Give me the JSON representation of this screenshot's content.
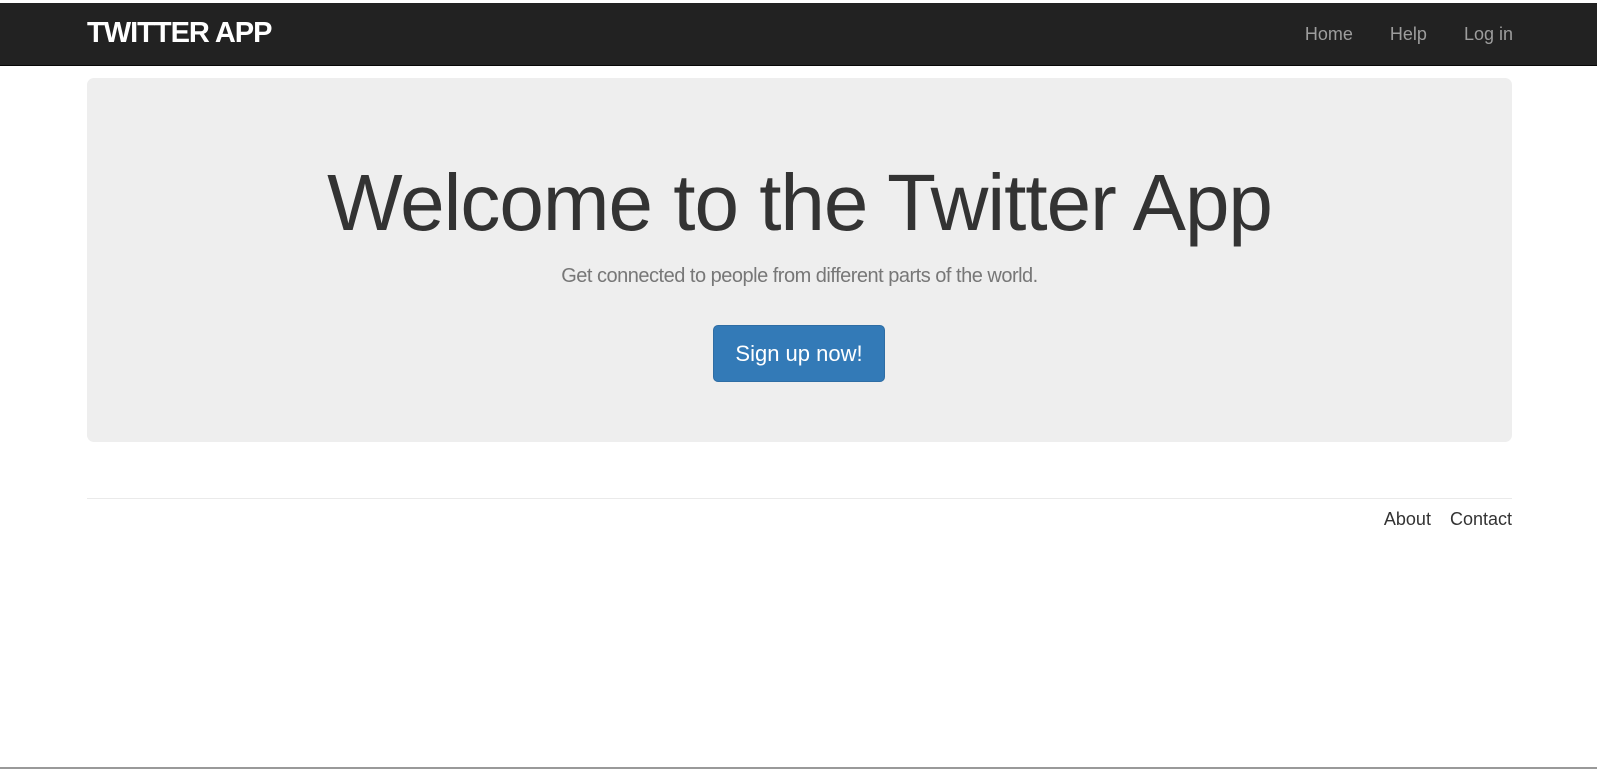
{
  "navbar": {
    "brand": "TWITTER APP",
    "links": [
      "Home",
      "Help",
      "Log in"
    ]
  },
  "hero": {
    "title": "Welcome to the Twitter App",
    "subtitle": "Get connected to people from different parts of the world.",
    "cta_label": "Sign up now!"
  },
  "footer": {
    "links": [
      "About",
      "Contact"
    ]
  },
  "colors": {
    "navbar_bg": "#222222",
    "jumbotron_bg": "#eeeeee",
    "primary_button": "#337ab7"
  }
}
